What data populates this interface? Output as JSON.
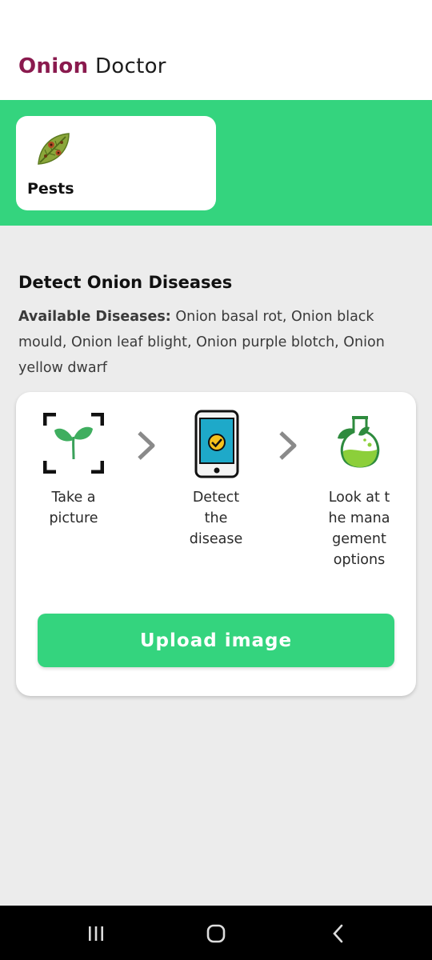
{
  "app": {
    "title_brand": "Onion",
    "title_rest": "Doctor"
  },
  "categories": [
    {
      "label": "Pests",
      "icon": "leaf-pest-icon"
    }
  ],
  "detect": {
    "title": "Detect Onion Diseases",
    "available_label": "Available Diseases:",
    "available_list": "Onion basal rot, Onion black mould, Onion leaf blight, Onion purple blotch, Onion yellow dwarf"
  },
  "steps": [
    {
      "label": "Take a picture",
      "icon": "camera-frame-sprout-icon"
    },
    {
      "label": "Detect the disease",
      "icon": "phone-check-icon"
    },
    {
      "label": "Look at the management options",
      "icon": "flask-leaf-icon"
    }
  ],
  "upload_button": "Upload image",
  "colors": {
    "brand": "#8a1a4e",
    "accent": "#34d47e",
    "background": "#ececec"
  },
  "system_nav": [
    "recent-apps-icon",
    "home-icon",
    "back-icon"
  ]
}
